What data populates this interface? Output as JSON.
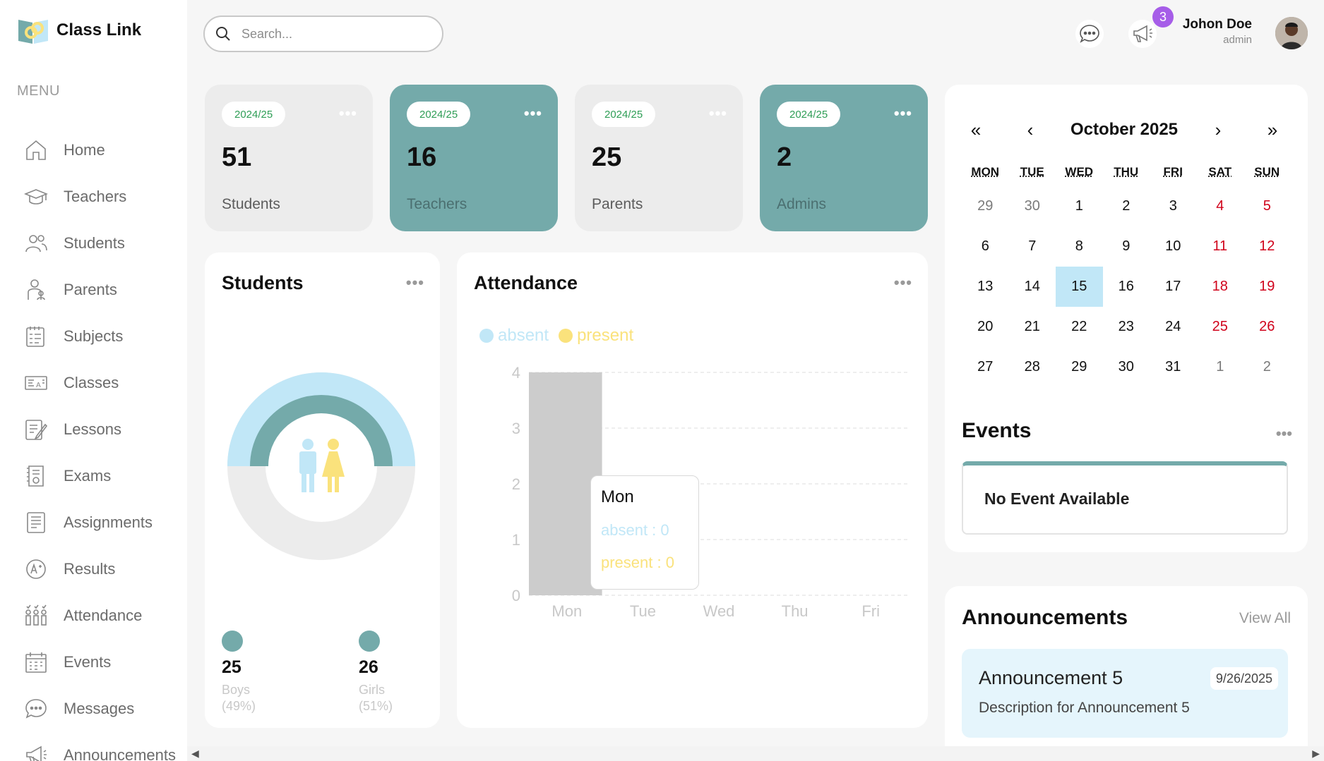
{
  "app": {
    "name": "Class Link",
    "menu_title": "MENU"
  },
  "sidebar": {
    "items": [
      {
        "label": "Home",
        "icon": "home-icon"
      },
      {
        "label": "Teachers",
        "icon": "teacher-icon"
      },
      {
        "label": "Students",
        "icon": "students-icon"
      },
      {
        "label": "Parents",
        "icon": "parents-icon"
      },
      {
        "label": "Subjects",
        "icon": "subjects-icon"
      },
      {
        "label": "Classes",
        "icon": "classes-icon"
      },
      {
        "label": "Lessons",
        "icon": "lessons-icon"
      },
      {
        "label": "Exams",
        "icon": "exams-icon"
      },
      {
        "label": "Assignments",
        "icon": "assignments-icon"
      },
      {
        "label": "Results",
        "icon": "results-icon"
      },
      {
        "label": "Attendance",
        "icon": "attendance-icon"
      },
      {
        "label": "Events",
        "icon": "events-icon"
      },
      {
        "label": "Messages",
        "icon": "messages-icon"
      },
      {
        "label": "Announcements",
        "icon": "announcements-icon"
      }
    ]
  },
  "topbar": {
    "search_placeholder": "Search...",
    "notification_count": "3",
    "user_name": "Johon Doe",
    "user_role": "admin"
  },
  "stats": [
    {
      "year": "2024/25",
      "value": "51",
      "label": "Students",
      "style": "light"
    },
    {
      "year": "2024/25",
      "value": "16",
      "label": "Teachers",
      "style": "teal"
    },
    {
      "year": "2024/25",
      "value": "25",
      "label": "Parents",
      "style": "light"
    },
    {
      "year": "2024/25",
      "value": "2",
      "label": "Admins",
      "style": "teal"
    }
  ],
  "students_panel": {
    "title": "Students",
    "boys": {
      "count": "25",
      "label": "Boys",
      "pct": "(49%)"
    },
    "girls": {
      "count": "26",
      "label": "Girls",
      "pct": "(51%)"
    }
  },
  "attendance": {
    "title": "Attendance",
    "legend": {
      "absent": "absent",
      "present": "present"
    },
    "tooltip": {
      "day": "Mon",
      "absent": "absent : 0",
      "present": "present : 0"
    }
  },
  "chart_data": {
    "type": "bar",
    "categories": [
      "Mon",
      "Tue",
      "Wed",
      "Thu",
      "Fri"
    ],
    "series": [
      {
        "name": "absent",
        "values": [
          0,
          0,
          0,
          0,
          0
        ]
      },
      {
        "name": "present",
        "values": [
          0,
          0,
          0,
          0,
          0
        ]
      }
    ],
    "yticks": [
      "0",
      "1",
      "2",
      "3",
      "4"
    ],
    "ylim": [
      0,
      4
    ],
    "highlight": "Mon",
    "colors": {
      "absent": "#c1e7f7",
      "present": "#fae27c",
      "highlight": "#cccccc"
    }
  },
  "calendar": {
    "prev_year": "«",
    "prev_month": "‹",
    "next_month": "›",
    "next_year": "»",
    "month_label": "October 2025",
    "weekdays": [
      "MON",
      "TUE",
      "WED",
      "THU",
      "FRI",
      "SAT",
      "SUN"
    ],
    "days": [
      "29",
      "30",
      "1",
      "2",
      "3",
      "4",
      "5",
      "6",
      "7",
      "8",
      "9",
      "10",
      "11",
      "12",
      "13",
      "14",
      "15",
      "16",
      "17",
      "18",
      "19",
      "20",
      "21",
      "22",
      "23",
      "24",
      "25",
      "26",
      "27",
      "28",
      "29",
      "30",
      "31",
      "1",
      "2"
    ],
    "today": "15"
  },
  "events": {
    "title": "Events",
    "empty": "No Event Available"
  },
  "announcements": {
    "title": "Announcements",
    "view_all": "View All",
    "items": [
      {
        "title": "Announcement 5",
        "date": "9/26/2025",
        "description": "Description for Announcement 5"
      }
    ]
  },
  "colors": {
    "teal": "#74aaaa",
    "light_blue": "#c1e7f7",
    "yellow": "#fae27c",
    "weekend_red": "#d0021b",
    "badge": "#a65de8"
  }
}
